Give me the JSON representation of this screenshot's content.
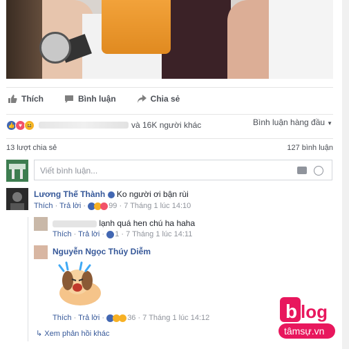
{
  "post": {
    "actions": {
      "like": "Thích",
      "comment": "Bình luận",
      "share": "Chia sẻ"
    },
    "reactions_text": "và 16K người khác",
    "top_comments": "Bình luận hàng đầu",
    "shares": "13 lượt chia sẻ",
    "comments_count": "127 bình luận"
  },
  "composer": {
    "placeholder": "Viết bình luận..."
  },
  "comments": [
    {
      "name": "Lương Thế Thành",
      "text": "Ko người ơi bận rùi",
      "like": "Thích",
      "reply": "Trả lời",
      "count": "99",
      "time": "7 Tháng 1 lúc 14:10"
    }
  ],
  "replies": [
    {
      "text": "lạnh quá hen chú ha haha",
      "like": "Thích",
      "reply": "Trả lời",
      "count": "1",
      "time": "7 Tháng 1 lúc 14:11"
    },
    {
      "name": "Nguyễn Ngọc Thúy Diễm",
      "like": "Thích",
      "reply": "Trả lời",
      "count": "36",
      "time": "7 Tháng 1 lúc 14:12"
    }
  ],
  "more_replies": "Xem phản hồi khác",
  "logo": {
    "main": "blog",
    "sub": "tâmsự.vn"
  },
  "colors": {
    "link": "#365899",
    "like_blue": "#4267b2",
    "love_red": "#f25268",
    "haha_yellow": "#f7b125",
    "logo_pink": "#e8175d"
  }
}
